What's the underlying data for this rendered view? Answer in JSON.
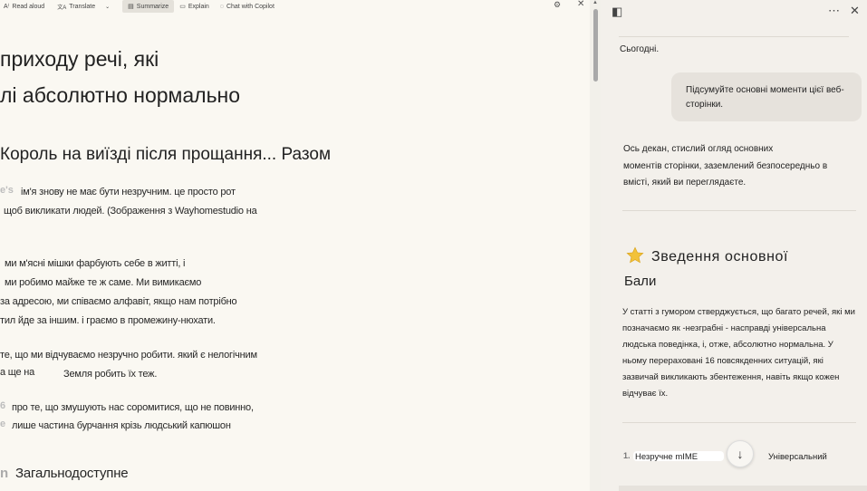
{
  "toolbar": {
    "read_aloud": "Read aloud",
    "translate": "Translate",
    "summarize": "Summarize",
    "explain": "Explain",
    "chat": "Chat with Copilot",
    "read_aloud_icon": "A⁾",
    "translate_icon": "文A",
    "gear_icon": "⚙",
    "close_icon": "✕"
  },
  "article": {
    "heading_line1": "приходу речі, які",
    "heading_line2": "лі абсолютно нормально",
    "subheading": "Король на виїзді після прощання... Разом",
    "p1_marker": "e's",
    "p1_line1": "ім'я знову не має бути незручним. це просто рот",
    "p1_line2": "щоб викликати людей. (Зображення з Wayhomestudio на",
    "p2_line1": "ми м'ясні мішки фарбують себе в житті, і",
    "p2_line2": "ми робимо майже те ж саме. Ми вимикаємо",
    "p2_line3": "за адресою, ми співаємо алфавіт, якщо нам потрібно",
    "p2_line4": "тил йде за іншим. і граємо в промежину-нюхати.",
    "p3_line1": "те, що ми відчуваємо незручно робити. який є нелогічним",
    "p3_line2a": "а ще на",
    "p3_line2b": "Земля робить їх теж.",
    "p4_marker": "6",
    "p4_line1": "про те, що змушують нас соромитися, що не повинно,",
    "p4_marker2": "e",
    "p4_line2": "лише частина бурчання крізь людський капюшон",
    "section_marker": "n",
    "section_heading": "Загальнодоступне"
  },
  "copilot": {
    "sidebar_icon": "◧",
    "more_icon": "⋯",
    "close_icon": "✕",
    "today": "Сьогодні.",
    "user_message": "Підсумуйте основні моменти цієї веб-сторінки.",
    "intro_line1": "Ось декан, стислий огляд основних",
    "intro_line2": "моментів сторінки, заземлений безпосередньо в",
    "intro_line3": "вмісті, який ви переглядаєте.",
    "section_title": "Зведення  основної",
    "section_title_line2": "Бали",
    "summary": "У статті з гумором стверджується, що багато речей, які ми позначаємо як -незграбні - насправді універсальна людська поведінка, і, отже, абсолютно нормальна. У ньому перераховані 16 повсякденних ситуацій, які зазвичай викликають збентеження, навіть якщо кожен відчуває їх.",
    "list_number": "1.",
    "list_left": "Незручне mIME",
    "list_right": "Універсальний",
    "down_icon": "↓"
  }
}
